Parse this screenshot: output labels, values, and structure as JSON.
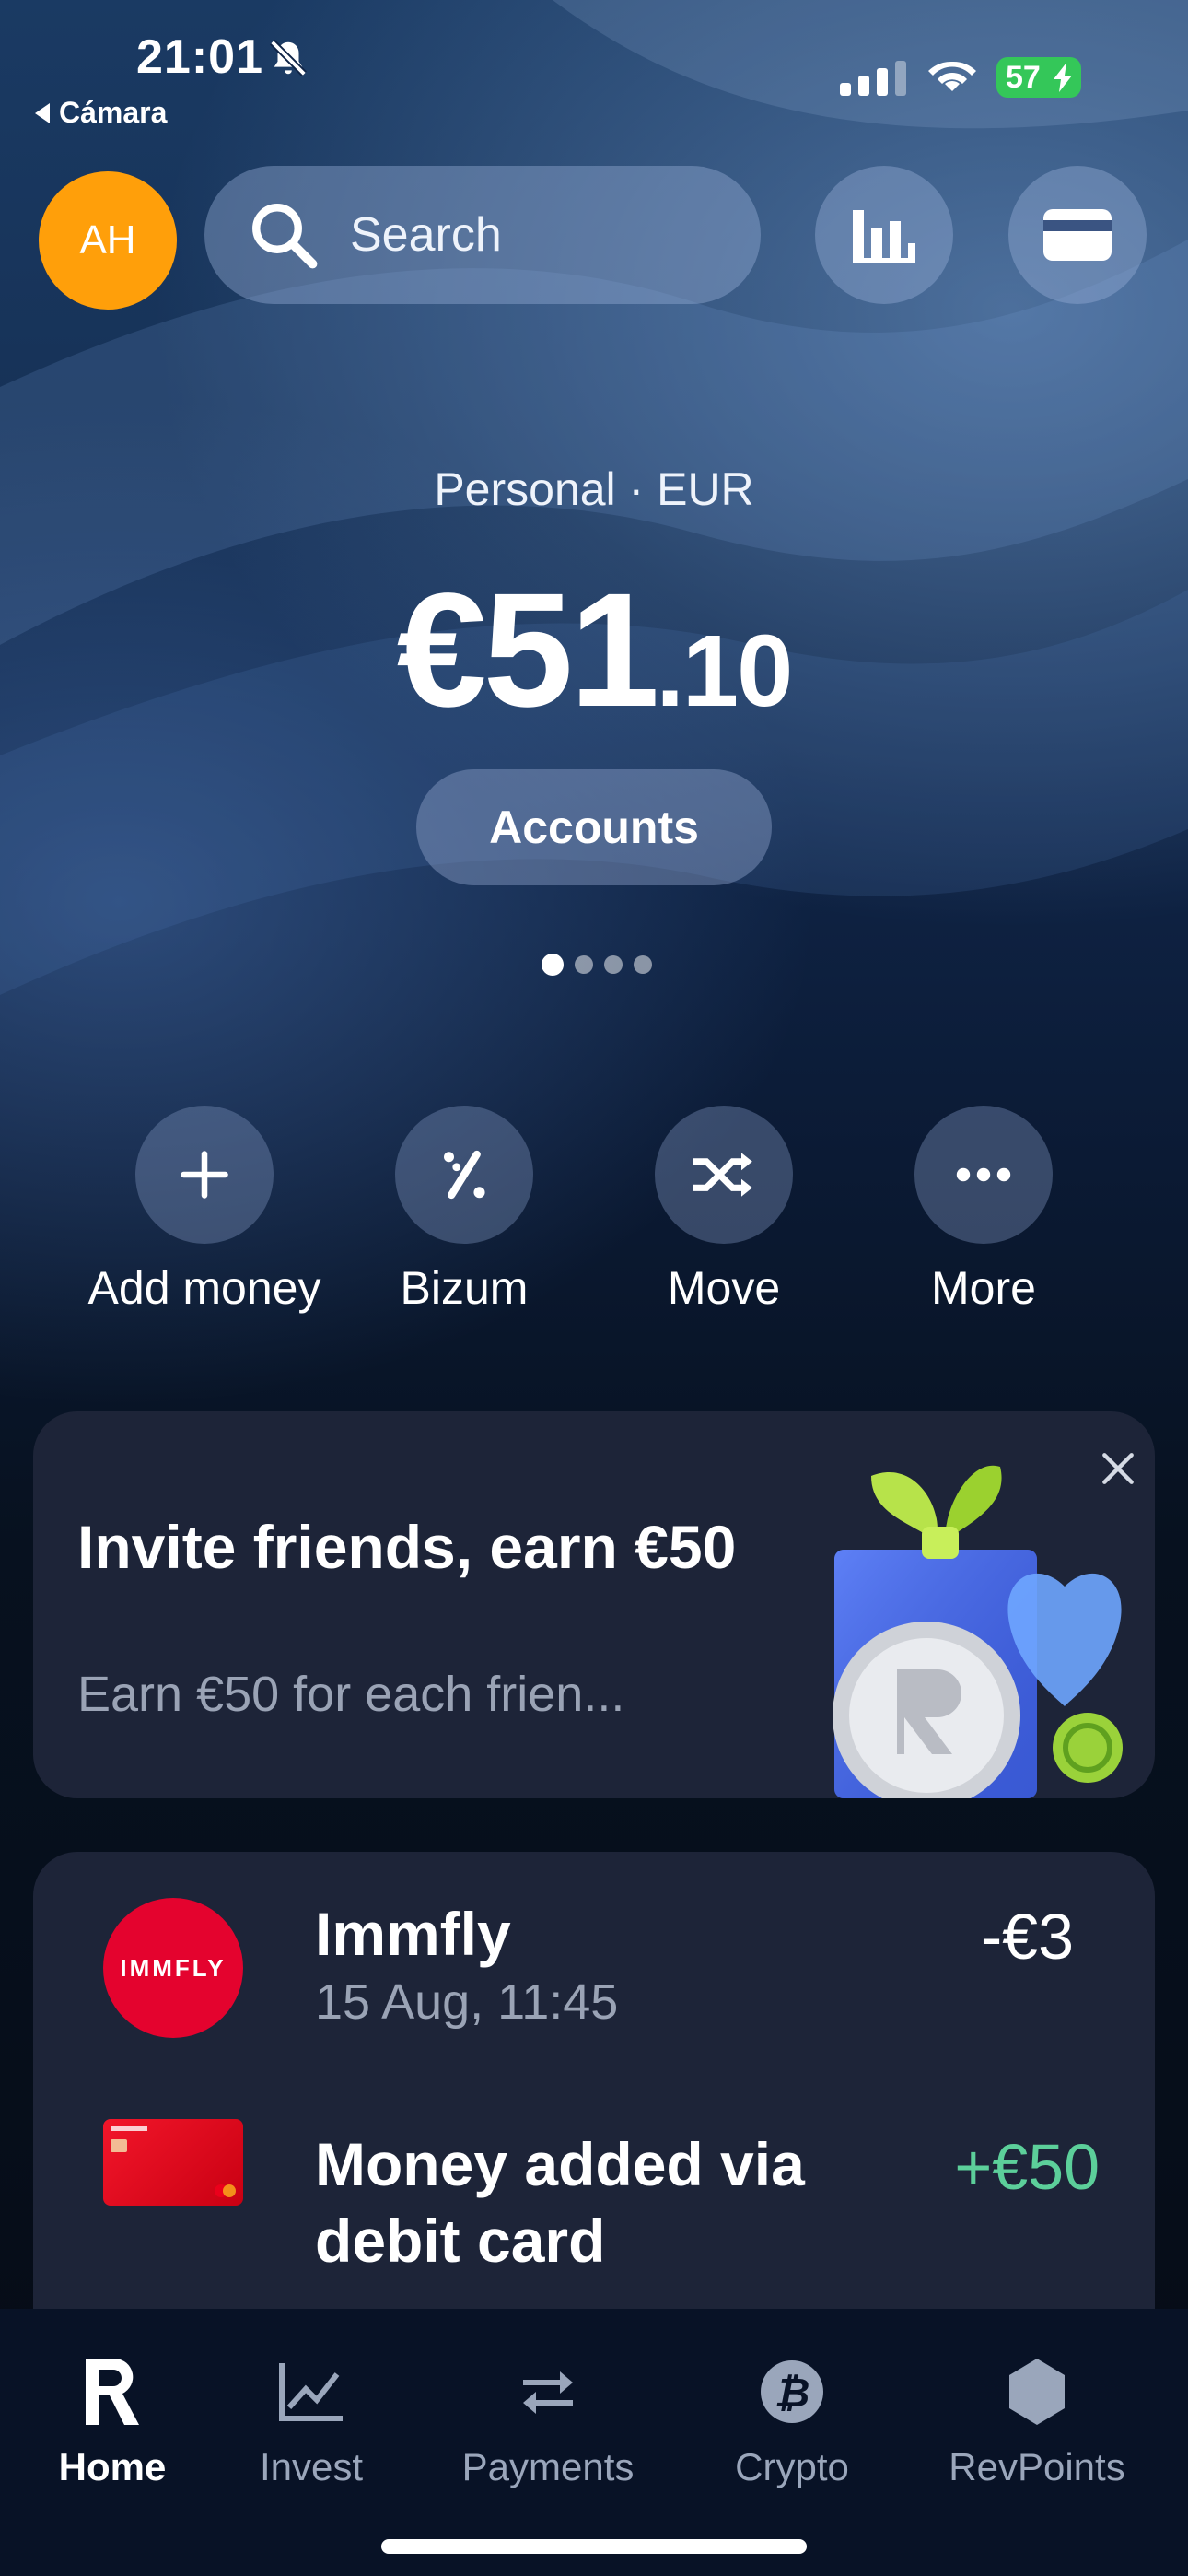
{
  "status_bar": {
    "time": "21:01",
    "back_app": "Cámara",
    "battery": "57"
  },
  "header": {
    "avatar_initials": "AH",
    "search_placeholder": "Search"
  },
  "balance": {
    "account_label": "Personal · EUR",
    "amount_main": "€51",
    "amount_cents": ".10",
    "accounts_button": "Accounts",
    "page_count": 4,
    "active_page": 1
  },
  "actions": [
    {
      "label": "Add money",
      "icon": "plus-icon"
    },
    {
      "label": "Bizum",
      "icon": "bizum-icon"
    },
    {
      "label": "Move",
      "icon": "shuffle-icon"
    },
    {
      "label": "More",
      "icon": "ellipsis-icon"
    }
  ],
  "invite": {
    "title": "Invite friends, earn €50",
    "subtitle": "Earn €50 for each frien..."
  },
  "transactions": [
    {
      "merchant": "Immfly",
      "logo_text": "IMMFLY",
      "date": "15 Aug, 11:45",
      "amount": "-€3"
    },
    {
      "merchant": "Money added via debit card",
      "amount": "+€50"
    }
  ],
  "tabbar": [
    {
      "label": "Home",
      "icon": "revolut-r-icon",
      "active": true
    },
    {
      "label": "Invest",
      "icon": "line-chart-icon"
    },
    {
      "label": "Payments",
      "icon": "transfer-arrows-icon"
    },
    {
      "label": "Crypto",
      "icon": "bitcoin-icon"
    },
    {
      "label": "RevPoints",
      "icon": "hexagon-icon"
    }
  ],
  "colors": {
    "avatar": "#ff9f0a",
    "battery": "#34c759",
    "immfly": "#e4032e",
    "positive_amount": "#5ccf9a",
    "card_bg": "#1d2438"
  }
}
